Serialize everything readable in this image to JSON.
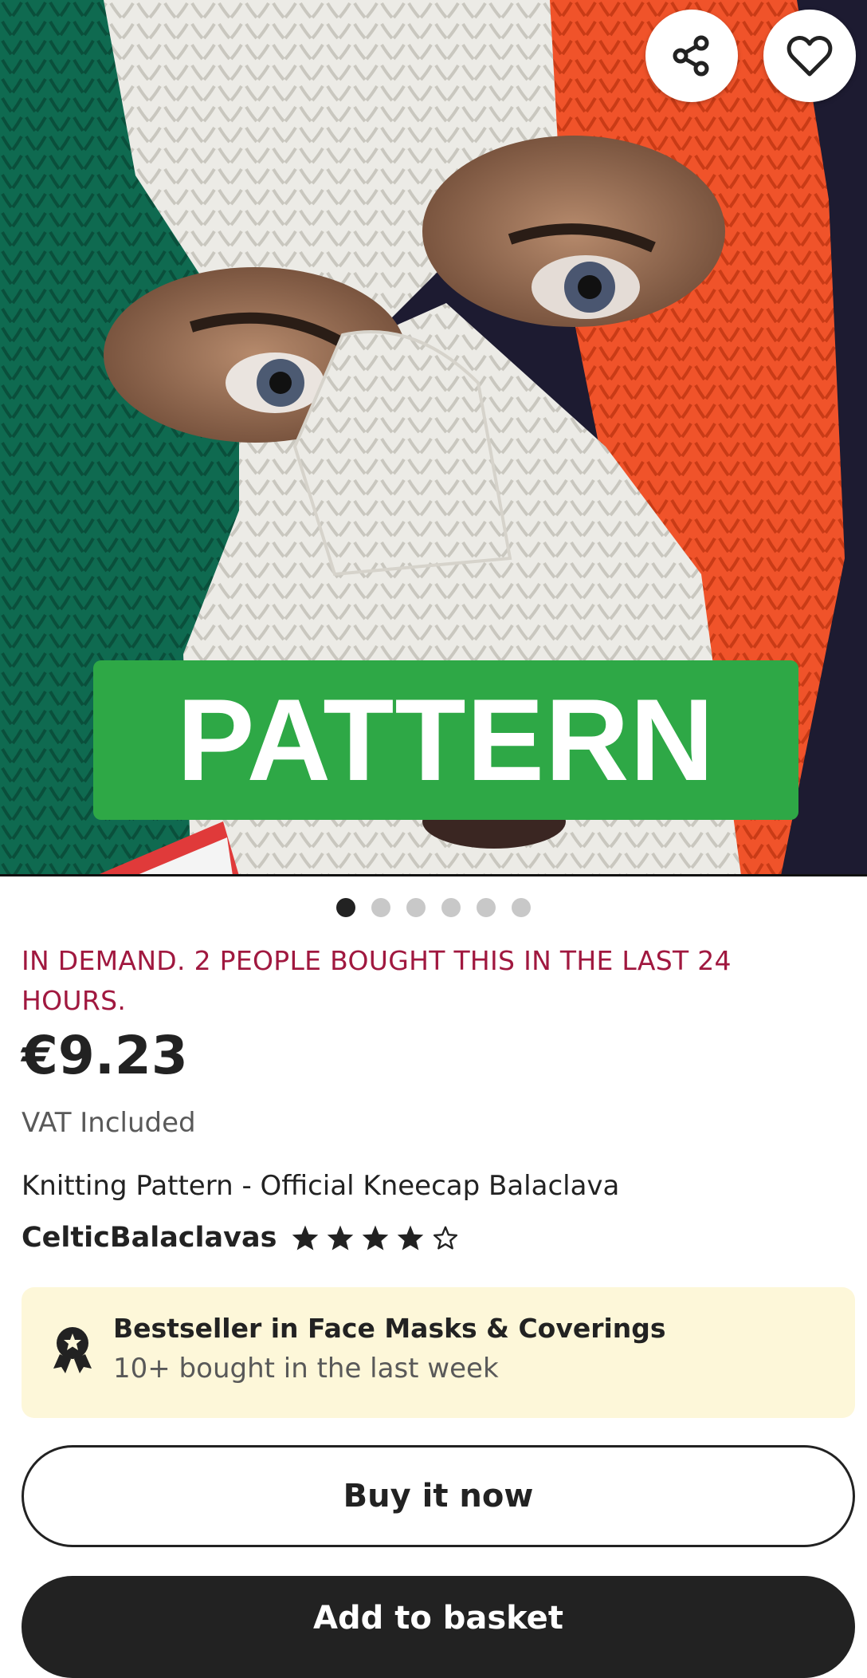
{
  "hero": {
    "banner_text": "PATTERN",
    "share_icon": "share-icon",
    "favorite_icon": "heart-icon",
    "image_count": 6,
    "active_image": 1
  },
  "product": {
    "demand_notice": "IN DEMAND. 2 PEOPLE BOUGHT THIS IN THE LAST 24 HOURS.",
    "price": "€9.23",
    "vat_note": "VAT Included",
    "title": "Knitting Pattern - Official Kneecap Balaclava",
    "shop_name": "CelticBalaclavas",
    "rating": 4,
    "rating_max": 5
  },
  "bestseller": {
    "icon": "award-icon",
    "title": "Bestseller in Face Masks & Coverings",
    "subtitle": "10+ bought in the last week"
  },
  "actions": {
    "buy_now": "Buy it now",
    "add_to_basket": "Add to basket"
  },
  "colors": {
    "demand_text": "#a0183f",
    "banner_green": "#2ea846",
    "bestseller_bg": "#fdf7d9",
    "dark": "#222222"
  }
}
